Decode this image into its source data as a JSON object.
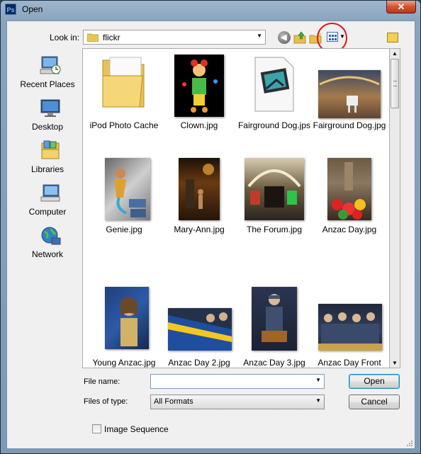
{
  "window": {
    "title": "Open",
    "app_icon": "Ps",
    "close_label": "✕"
  },
  "toolbar": {
    "lookin_label": "Look in:",
    "lookin_value": "flickr",
    "icons": [
      "back-icon",
      "up-folder-icon",
      "new-folder-icon",
      "views-menu-icon",
      "favorite-folder-icon"
    ]
  },
  "places": [
    {
      "label": "Recent Places",
      "icon": "recent-places-icon"
    },
    {
      "label": "Desktop",
      "icon": "desktop-icon"
    },
    {
      "label": "Libraries",
      "icon": "libraries-icon"
    },
    {
      "label": "Computer",
      "icon": "computer-icon"
    },
    {
      "label": "Network",
      "icon": "network-icon"
    }
  ],
  "files": [
    {
      "label": "iPod Photo Cache",
      "kind": "folder"
    },
    {
      "label": "Clown.jpg",
      "kind": "photo"
    },
    {
      "label": "Fairground Dog.jps",
      "kind": "document"
    },
    {
      "label": "Fairground Dog.jpg",
      "kind": "photo"
    },
    {
      "label": "Genie.jpg",
      "kind": "photo"
    },
    {
      "label": "Mary-Ann.jpg",
      "kind": "photo"
    },
    {
      "label": "The Forum.jpg",
      "kind": "photo"
    },
    {
      "label": "Anzac Day.jpg",
      "kind": "photo"
    },
    {
      "label": "Young Anzac.jpg",
      "kind": "photo"
    },
    {
      "label": "Anzac Day 2.jpg",
      "kind": "photo"
    },
    {
      "label": "Anzac Day 3.jpg",
      "kind": "photo"
    },
    {
      "label": "Anzac Day Front Row.jpg",
      "kind": "photo"
    }
  ],
  "form": {
    "filename_label": "File name:",
    "filename_value": "",
    "filetype_label": "Files of type:",
    "filetype_value": "All Formats",
    "open_label": "Open",
    "cancel_label": "Cancel",
    "sequence_label": "Image Sequence",
    "sequence_checked": false
  },
  "colors": {
    "highlight_circle": "#e0161b",
    "accent": "#3c7fb1"
  }
}
